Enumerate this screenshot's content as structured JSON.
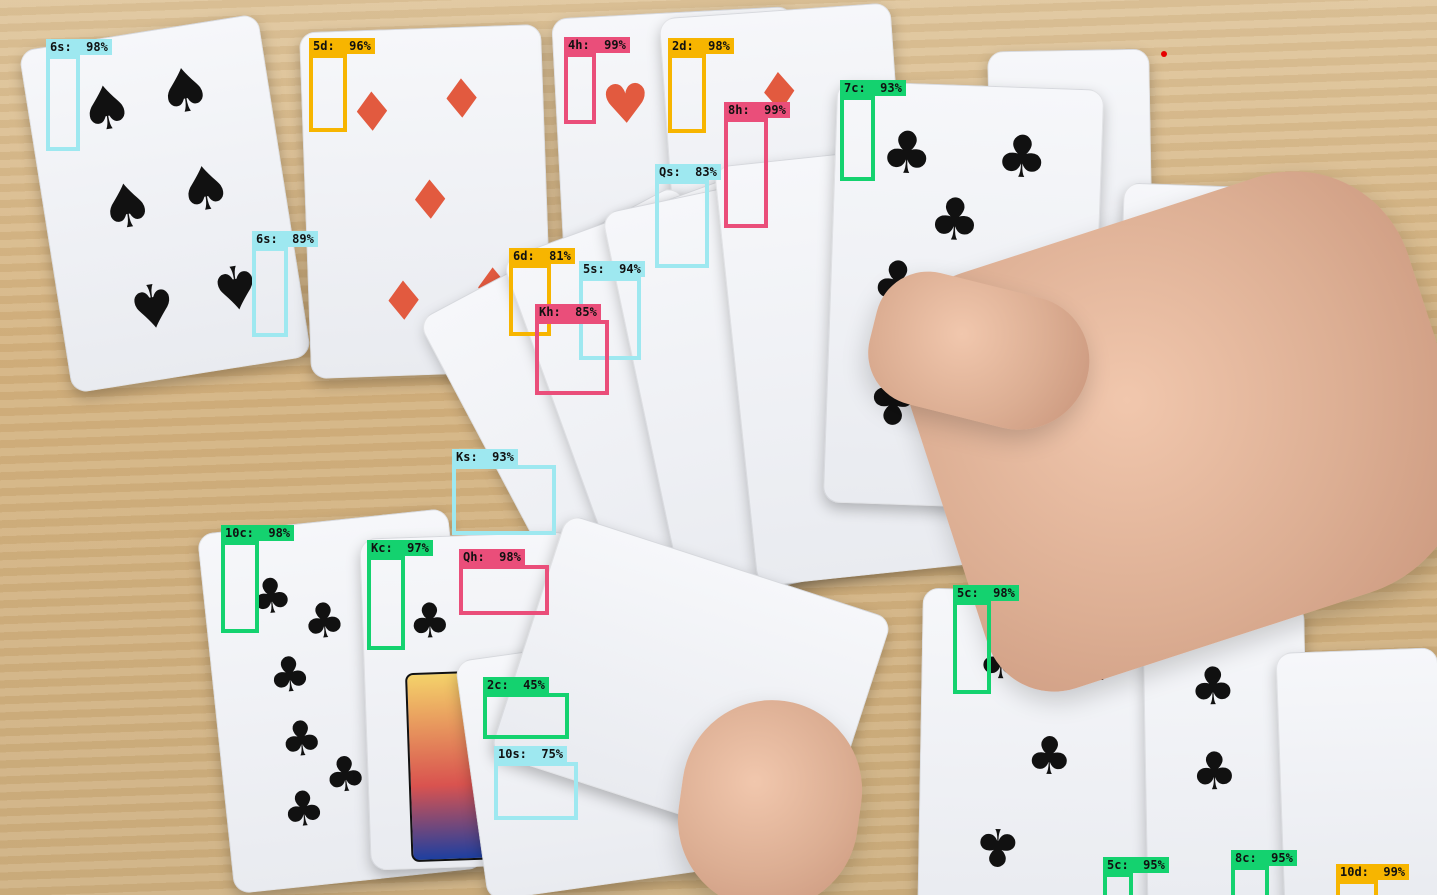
{
  "image": {
    "scene": "playing-cards-with-detection-overlays"
  },
  "colors": {
    "spade": "#9ee8f0",
    "diamond": "#f7b500",
    "heart": "#ea4e7a",
    "club": "#14d26f",
    "table_wood": "#d8b98b",
    "card_face": "#f2f3f7",
    "red_suit": "#e25a3f",
    "black_suit": "#111111"
  },
  "detections": [
    {
      "label": "6s:  98%",
      "suit": "spade"
    },
    {
      "label": "5d:  96%",
      "suit": "diamond"
    },
    {
      "label": "4h:  99%",
      "suit": "heart"
    },
    {
      "label": "2d:  98%",
      "suit": "diamond"
    },
    {
      "label": "8h:  99%",
      "suit": "heart"
    },
    {
      "label": "7c:  93%",
      "suit": "club"
    },
    {
      "label": "Qs:  83%",
      "suit": "spade"
    },
    {
      "label": "6s:  89%",
      "suit": "spade"
    },
    {
      "label": "6d:  81%",
      "suit": "diamond"
    },
    {
      "label": "5s:  94%",
      "suit": "spade"
    },
    {
      "label": "Kh:  85%",
      "suit": "heart"
    },
    {
      "label": "Ks:  93%",
      "suit": "spade"
    },
    {
      "label": "10c:  98%",
      "suit": "club"
    },
    {
      "label": "Kc:  97%",
      "suit": "club"
    },
    {
      "label": "Qh:  98%",
      "suit": "heart"
    },
    {
      "label": "2c:  45%",
      "suit": "club"
    },
    {
      "label": "10s:  75%",
      "suit": "spade"
    },
    {
      "label": "5c:  98%",
      "suit": "club"
    },
    {
      "label": "5c:  95%",
      "suit": "club"
    },
    {
      "label": "8c:  95%",
      "suit": "club"
    },
    {
      "label": "10d:  99%",
      "suit": "diamond"
    }
  ]
}
